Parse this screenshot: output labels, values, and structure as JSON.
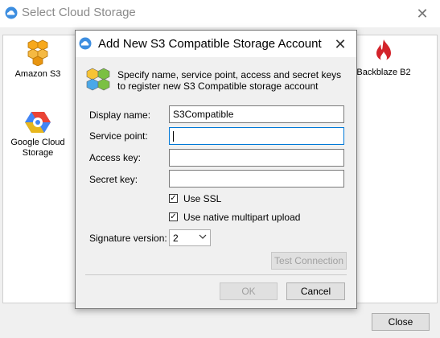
{
  "window": {
    "title": "Select Cloud Storage",
    "close_glyph": "✕",
    "close_button_label": "Close"
  },
  "providers": {
    "amazon": {
      "label": "Amazon S3",
      "icon": "amazon-s3-icon"
    },
    "google": {
      "label": "Google Cloud Storage",
      "icon": "google-cloud-icon"
    },
    "backblaze": {
      "label": "Backblaze B2",
      "icon": "backblaze-icon"
    }
  },
  "dialog": {
    "title": "Add New S3 Compatible Storage Account",
    "close_glyph": "✕",
    "info": "Specify name, service point, access and secret keys to register new S3 Compatible storage account",
    "fields": {
      "display_name": {
        "label": "Display name:",
        "value": "S3Compatible"
      },
      "service_point": {
        "label": "Service point:",
        "value": ""
      },
      "access_key": {
        "label": "Access key:",
        "value": ""
      },
      "secret_key": {
        "label": "Secret key:",
        "value": ""
      }
    },
    "use_ssl": {
      "label": "Use SSL",
      "checked": true,
      "glyph": "✓"
    },
    "multipart": {
      "label": "Use native multipart upload",
      "checked": true,
      "glyph": "✓"
    },
    "signature": {
      "label": "Signature version:",
      "value": "2"
    },
    "buttons": {
      "test": "Test Connection",
      "ok": "OK",
      "cancel": "Cancel"
    }
  },
  "colors": {
    "accent_focus": "#0078d7",
    "backblaze_red": "#d3232a",
    "amazon_orange": "#f7a81b"
  }
}
